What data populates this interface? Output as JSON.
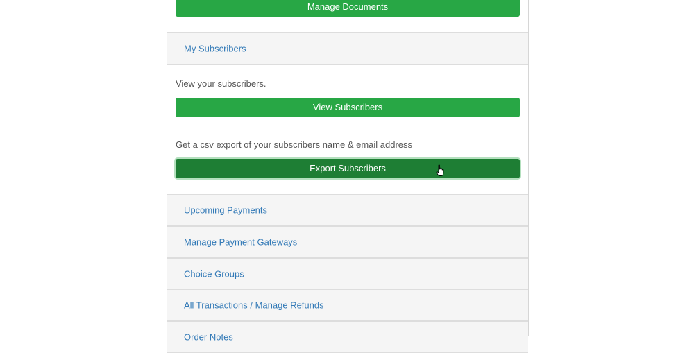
{
  "documents": {
    "manage_button": "Manage Documents"
  },
  "subscribers": {
    "heading": "My Subscribers",
    "view_description": "View your subscribers.",
    "view_button": "View Subscribers",
    "export_description": "Get a csv export of your subscribers name & email address",
    "export_button": "Export Subscribers"
  },
  "sections": [
    {
      "label": "Upcoming Payments"
    },
    {
      "label": "Manage Payment Gateways"
    },
    {
      "label": "Choice Groups"
    },
    {
      "label": "All Transactions / Manage Refunds"
    },
    {
      "label": "Order Notes"
    }
  ],
  "colors": {
    "button_green": "#28a745",
    "button_green_active": "#1e7e34",
    "link_blue": "#337ab7",
    "heading_bg": "#f5f5f5"
  },
  "icons": {
    "cursor": "hand-pointer-icon"
  }
}
